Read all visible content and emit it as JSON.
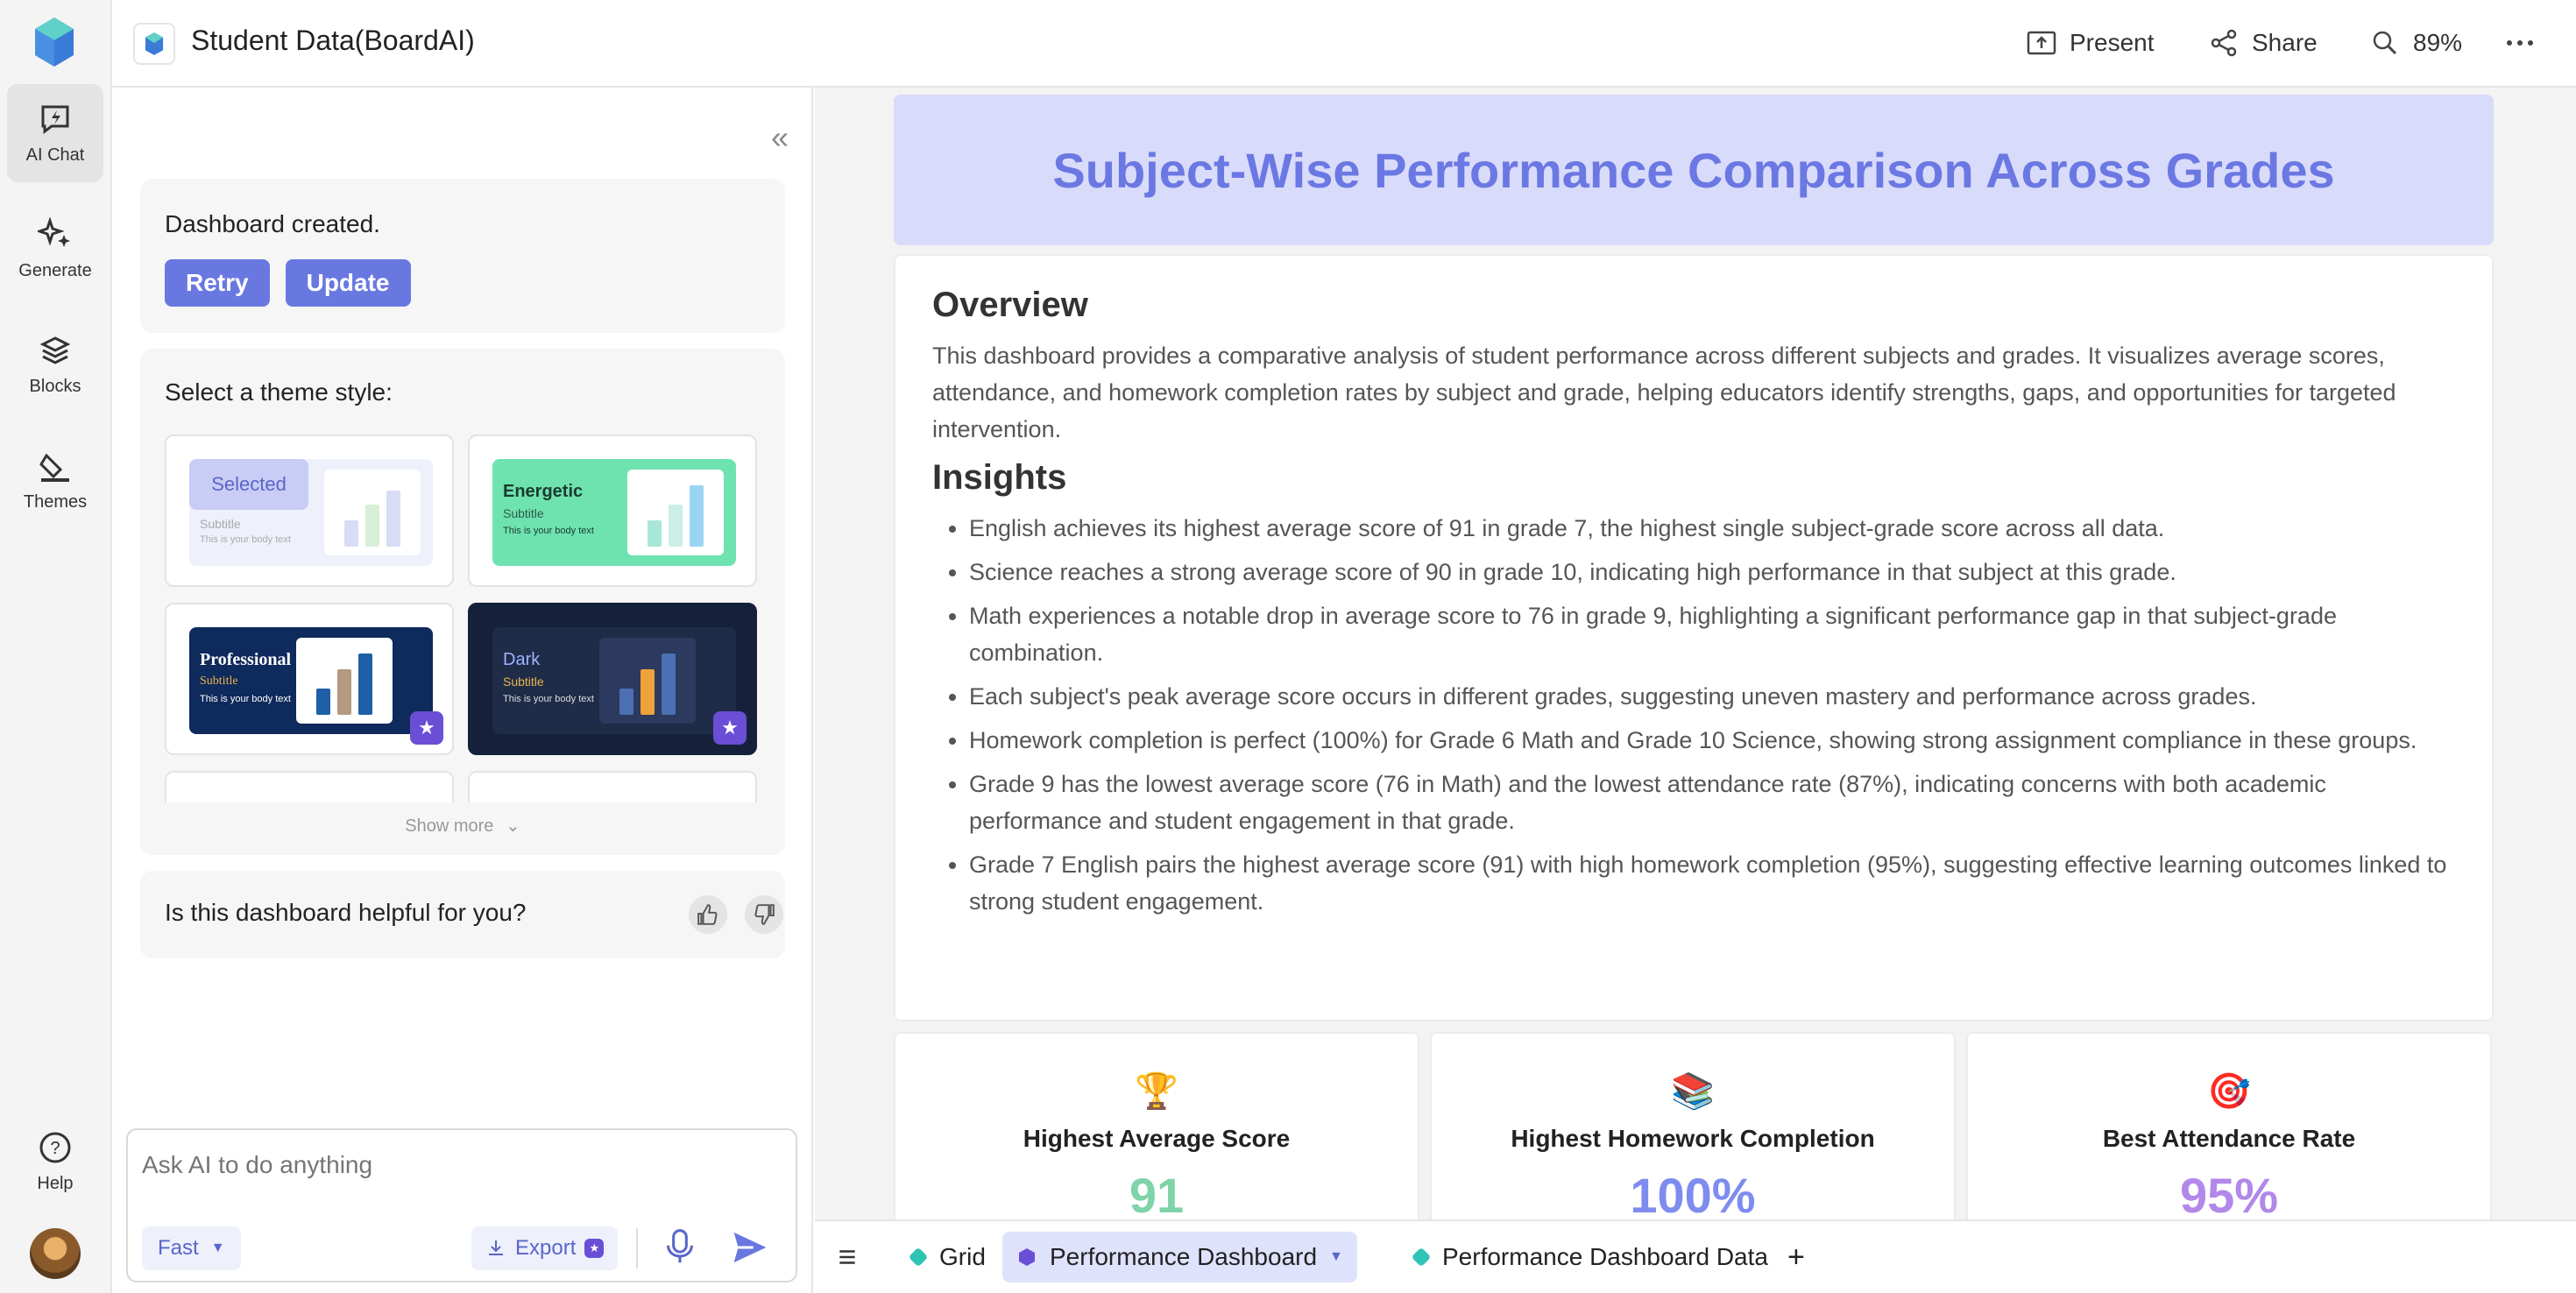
{
  "app": {
    "doc_title": "Student Data(BoardAI)"
  },
  "rail": {
    "items": [
      {
        "label": "AI Chat"
      },
      {
        "label": "Generate"
      },
      {
        "label": "Blocks"
      },
      {
        "label": "Themes"
      }
    ],
    "help_label": "Help"
  },
  "topbar": {
    "present_label": "Present",
    "share_label": "Share",
    "zoom_label": "89%"
  },
  "chat": {
    "status": "Dashboard created.",
    "retry_label": "Retry",
    "update_label": "Update",
    "theme_prompt": "Select a theme style:",
    "themes": [
      {
        "name": "Selected",
        "subtitle": "Subtitle",
        "body": "This is your body text"
      },
      {
        "name": "Energetic",
        "subtitle": "Subtitle",
        "body": "This is your body text"
      },
      {
        "name": "Professional",
        "subtitle": "Subtitle",
        "body": "This is your body text"
      },
      {
        "name": "Dark",
        "subtitle": "Subtitle",
        "body": "This is your body text"
      }
    ],
    "show_more": "Show more",
    "feedback_question": "Is this dashboard helpful for you?",
    "input_placeholder": "Ask AI to do anything",
    "mode_label": "Fast",
    "export_label": "Export"
  },
  "dashboard": {
    "title": "Subject-Wise Performance Comparison Across Grades",
    "overview_heading": "Overview",
    "overview_text": "This dashboard provides a comparative analysis of student performance across different subjects and grades. It visualizes average scores, attendance, and homework completion rates by subject and grade, helping educators identify strengths, gaps, and opportunities for targeted intervention.",
    "insights_heading": "Insights",
    "insights": [
      "English achieves its highest average score of 91 in grade 7, the highest single subject-grade score across all data.",
      "Science reaches a strong average score of 90 in grade 10, indicating high performance in that subject at this grade.",
      "Math experiences a notable drop in average score to 76 in grade 9, highlighting a significant performance gap in that subject-grade combination.",
      "Each subject's peak average score occurs in different grades, suggesting uneven mastery and performance across grades.",
      "Homework completion is perfect (100%) for Grade 6 Math and Grade 10 Science, showing strong assignment compliance in these groups.",
      "Grade 9 has the lowest average score (76 in Math) and the lowest attendance rate (87%), indicating concerns with both academic performance and student engagement in that grade.",
      "Grade 7 English pairs the highest average score (91) with high homework completion (95%), suggesting effective learning outcomes linked to strong student engagement."
    ],
    "stats": [
      {
        "emoji": "🏆",
        "label": "Highest Average Score",
        "value": "91",
        "color": "#7fd3a8"
      },
      {
        "emoji": "📚",
        "label": "Highest Homework Completion",
        "value": "100%",
        "color": "#7e8cf0"
      },
      {
        "emoji": "🎯",
        "label": "Best Attendance Rate",
        "value": "95%",
        "color": "#b288ea"
      }
    ]
  },
  "tabs": [
    {
      "label": "Grid"
    },
    {
      "label": "Performance Dashboard"
    },
    {
      "label": "Performance Dashboard Data"
    }
  ]
}
